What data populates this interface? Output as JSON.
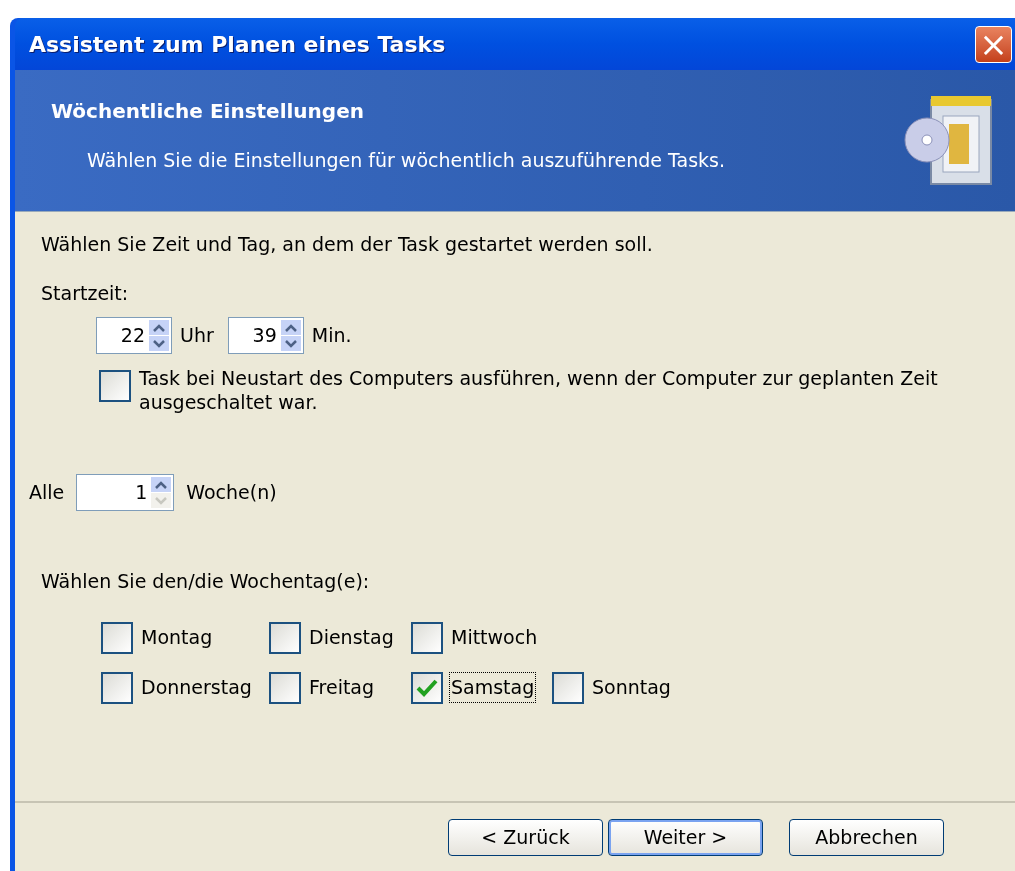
{
  "window": {
    "title": "Assistent zum Planen eines Tasks",
    "close": "×"
  },
  "header": {
    "title": "Wöchentliche Einstellungen",
    "subtitle": "Wählen Sie die Einstellungen für wöchentlich auszuführende Tasks."
  },
  "intro": "Wählen Sie Zeit und Tag, an dem der Task gestartet werden soll.",
  "start_time": {
    "label": "Startzeit:",
    "hour": {
      "value": "22",
      "unit": "Uhr"
    },
    "minute": {
      "value": "39",
      "unit": "Min."
    }
  },
  "restart_option": {
    "label": "Task bei Neustart des Computers ausführen, wenn der Computer zur geplanten Zeit ausgeschaltet war.",
    "checked": false
  },
  "interval": {
    "label": "Alle",
    "value": "1",
    "unit": "Woche(n)",
    "down_disabled": true
  },
  "days_label": "Wählen Sie den/die Wochentag(e):",
  "days": [
    {
      "label": "Montag",
      "checked": false,
      "focused": false
    },
    {
      "label": "Dienstag",
      "checked": false,
      "focused": false
    },
    {
      "label": "Mittwoch",
      "checked": false,
      "focused": false
    },
    {
      "label": "Donnerstag",
      "checked": false,
      "focused": false
    },
    {
      "label": "Freitag",
      "checked": false,
      "focused": false
    },
    {
      "label": "Samstag",
      "checked": true,
      "focused": true
    },
    {
      "label": "Sonntag",
      "checked": false,
      "focused": false
    }
  ],
  "buttons": [
    {
      "label": "< Zurück",
      "default": false
    },
    {
      "label": "Weiter >",
      "default": true
    },
    {
      "label": "Abbrechen",
      "default": false
    }
  ]
}
